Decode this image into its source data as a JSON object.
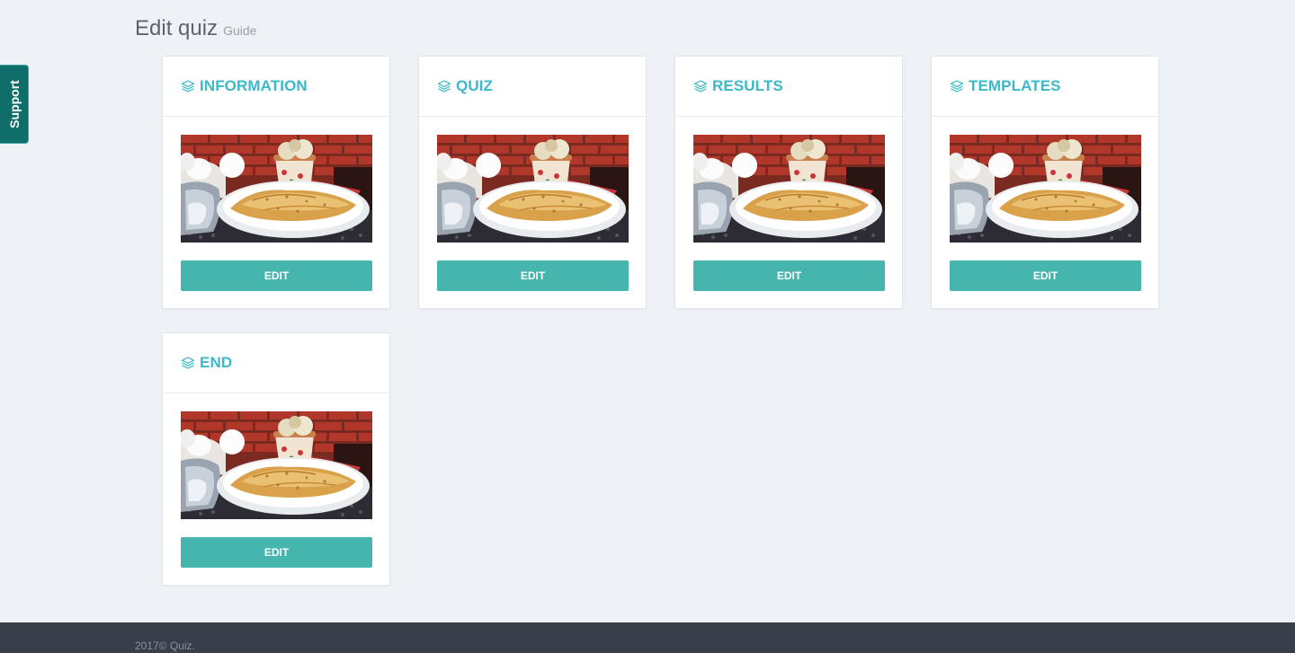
{
  "header": {
    "title": "Edit quiz",
    "subtitle": "Guide"
  },
  "support": {
    "label": "Support"
  },
  "cards": [
    {
      "title": "INFORMATION",
      "button": "EDIT"
    },
    {
      "title": "QUIZ",
      "button": "EDIT"
    },
    {
      "title": "RESULTS",
      "button": "EDIT"
    },
    {
      "title": "TEMPLATES",
      "button": "EDIT"
    },
    {
      "title": "END",
      "button": "EDIT"
    }
  ],
  "card_icon": "layers-icon",
  "card_image": "crepes-plate-photo",
  "footer": {
    "text": "2017© Quiz."
  },
  "colors": {
    "accent": "#3bb9c8",
    "button": "#45b5ad",
    "support_tab": "#0f6e6a",
    "footer": "#373f4a",
    "background": "#eef1f6"
  }
}
